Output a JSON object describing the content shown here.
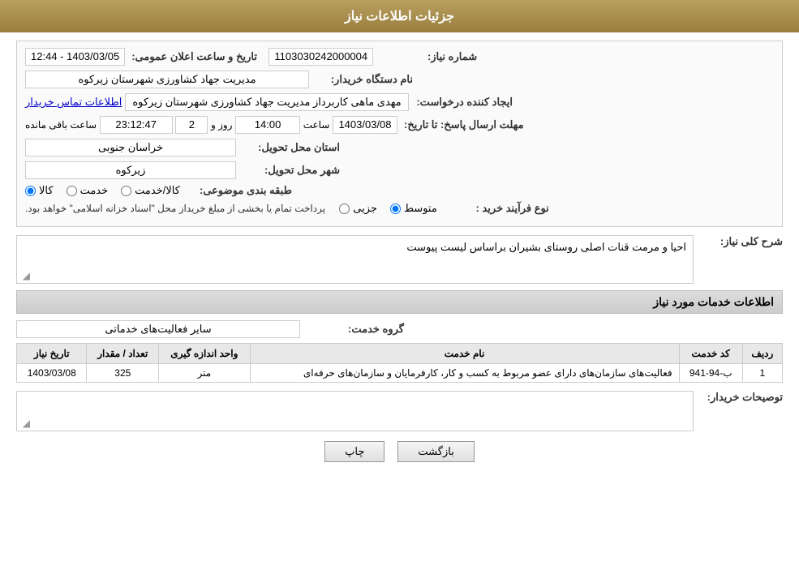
{
  "header": {
    "title": "جزئیات اطلاعات نیاز"
  },
  "fields": {
    "need_number_label": "شماره نیاز:",
    "need_number_value": "1103030242000004",
    "announcement_label": "تاریخ و ساعت اعلان عمومی:",
    "announcement_value": "1403/03/05 - 12:44",
    "buyer_org_label": "نام دستگاه خریدار:",
    "buyer_org_value": "مدیریت جهاد کشاورزی شهرستان زیرکوه",
    "creator_label": "ایجاد کننده درخواست:",
    "creator_value": "مهدی ماهی کاربرداز مدیریت جهاد کشاورزی شهرستان زیرکوه",
    "creator_link": "اطلاعات تماس خریدار",
    "response_deadline_label": "مهلت ارسال پاسخ: تا تاریخ:",
    "response_date_value": "1403/03/08",
    "response_time_label": "ساعت",
    "response_time_value": "14:00",
    "remaining_day_label": "روز و",
    "remaining_day_value": "2",
    "remaining_time_value": "23:12:47",
    "remaining_suffix": "ساعت باقی مانده",
    "province_label": "استان محل تحویل:",
    "province_value": "خراسان جنوبی",
    "city_label": "شهر محل تحویل:",
    "city_value": "زیرکوه",
    "category_label": "طبقه بندی موضوعی:",
    "category_options": [
      "کالا",
      "خدمت",
      "کالا/خدمت"
    ],
    "category_selected": "کالا",
    "process_label": "نوع فرآیند خرید :",
    "process_options": [
      "جزیی",
      "متوسط"
    ],
    "process_selected": "متوسط",
    "process_notice": "پرداخت تمام یا بخشی از مبلغ خریداز محل \"اسناد خزانه اسلامی\" خواهد بود.",
    "need_desc_label": "شرح کلی نیاز:",
    "need_desc_value": "احیا و مرمت قنات اصلی روستای بشیران براساس لیست پیوست"
  },
  "services_section": {
    "title": "اطلاعات خدمات مورد نیاز",
    "service_group_label": "گروه خدمت:",
    "service_group_value": "سایر فعالیت‌های خدماتی",
    "table": {
      "headers": [
        "ردیف",
        "کد خدمت",
        "نام خدمت",
        "واحد اندازه گیری",
        "تعداد / مقدار",
        "تاریخ نیاز"
      ],
      "rows": [
        {
          "row": "1",
          "code": "ب-94-941",
          "name": "فعالیت‌های سازمان‌های دارای عضو مربوط به کسب و کار، کارفرمایان و سازمان‌های حرفه‌ای",
          "unit": "متر",
          "quantity": "325",
          "date": "1403/03/08"
        }
      ]
    }
  },
  "buyer_desc": {
    "label": "توصیحات خریدار:",
    "value": ""
  },
  "buttons": {
    "print_label": "چاپ",
    "back_label": "بازگشت"
  }
}
